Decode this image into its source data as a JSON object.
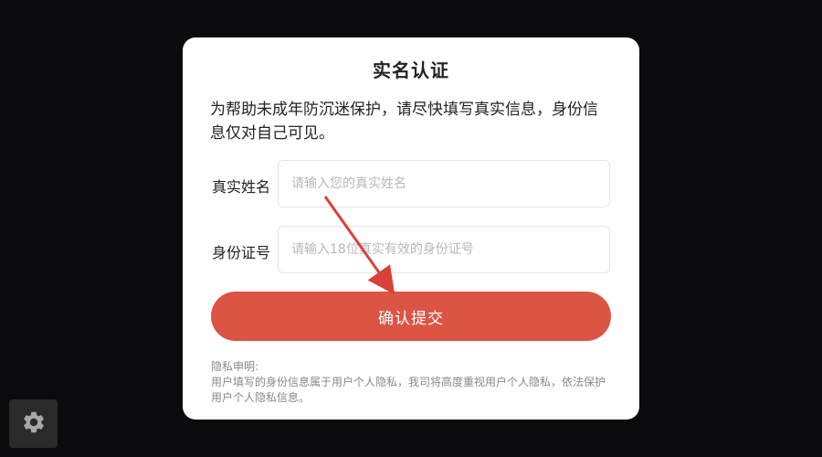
{
  "dialog": {
    "title": "实名认证",
    "description": "为帮助未成年防沉迷保护，请尽快填写真实信息，身份信息仅对自己可见。",
    "name_label": "真实姓名",
    "name_placeholder": "请输入您的真实姓名",
    "name_value": "",
    "id_label": "身份证号",
    "id_placeholder": "请输入18位真实有效的身份证号",
    "id_value": "",
    "submit_label": "确认提交",
    "privacy_title": "隐私申明:",
    "privacy_text": "用户填写的身份信息属于用户个人隐私，我司将高度重视用户个人隐私，依法保护用户个人隐私信息。"
  },
  "settings": {
    "icon": "gear-icon"
  },
  "colors": {
    "accent": "#db5444",
    "annotation_arrow": "#d9403a",
    "background": "#0b0b0d"
  }
}
